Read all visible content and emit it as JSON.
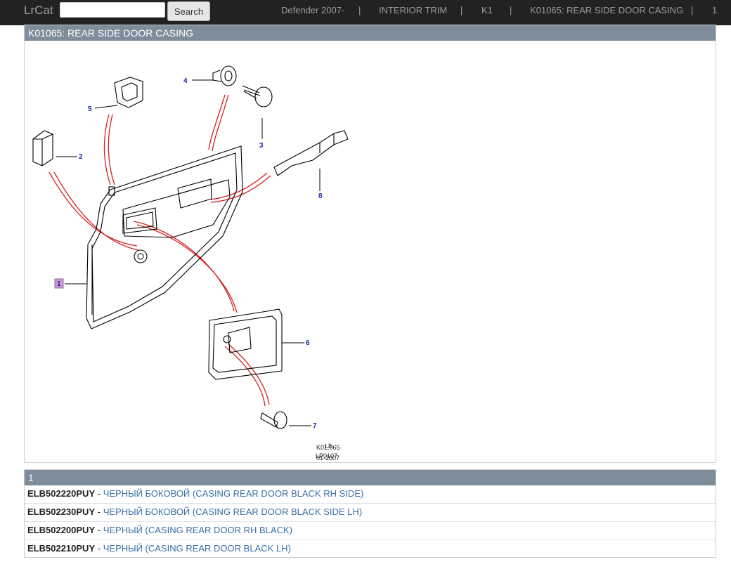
{
  "navbar": {
    "brand": "LrCat",
    "search": {
      "value": "",
      "placeholder": ""
    },
    "search_button": "Search",
    "breadcrumbs": [
      "Defender 2007-",
      "|",
      "INTERIOR TRIM",
      "|",
      "K1",
      "|",
      "K01065: REAR SIDE DOOR CASING",
      "|",
      "1"
    ]
  },
  "diagram": {
    "title": "K01065: REAR SIDE DOOR CASING",
    "callouts": [
      "1",
      "2",
      "3",
      "4",
      "5",
      "6",
      "7",
      "8"
    ],
    "stamp": [
      "K01.065",
      "01-2007",
      "L8",
      "LP0107"
    ]
  },
  "parts": {
    "header": "1",
    "rows": [
      {
        "number": "ELB502220PUY",
        "sep": " - ",
        "description": "ЧЕРНЫЙ БОКОВОЙ (CASING REAR DOOR BLACK RH SIDE)"
      },
      {
        "number": "ELB502230PUY",
        "sep": " - ",
        "description": "ЧЕРНЫЙ БОКОВОЙ (CASING REAR DOOR BLACK SIDE LH)"
      },
      {
        "number": "ELB502200PUY",
        "sep": " - ",
        "description": "ЧЕРНЫЙ (CASING REAR DOOR RH BLACK)"
      },
      {
        "number": "ELB502210PUY",
        "sep": " - ",
        "description": "ЧЕРНЫЙ (CASING REAR DOOR BLACK LH)"
      }
    ]
  },
  "colors": {
    "navbar_bg": "#222222",
    "panel_header_bg": "#7f8d9a",
    "link": "#3b6fa8",
    "callout": "#1a2ab0",
    "highlight": "#cc99cc",
    "leader_red": "#d42020"
  }
}
